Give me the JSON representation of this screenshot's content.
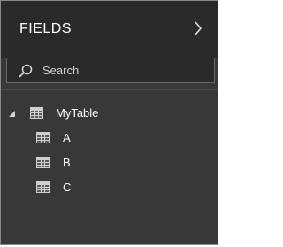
{
  "pane": {
    "title": "FIELDS",
    "collapse_icon": "chevron-right-icon"
  },
  "search": {
    "icon": "search-icon",
    "placeholder": "Search",
    "value": ""
  },
  "tree": {
    "table": {
      "label": "MyTable",
      "expanded": true,
      "icon": "table-icon",
      "fields": [
        {
          "label": "A",
          "icon": "table-icon"
        },
        {
          "label": "B",
          "icon": "table-icon"
        },
        {
          "label": "C",
          "icon": "table-icon"
        }
      ]
    }
  },
  "colors": {
    "pane_background": "#383838",
    "header_background": "#2a2a2a",
    "text": "#ffffff",
    "icon": "#cfcfcf"
  }
}
